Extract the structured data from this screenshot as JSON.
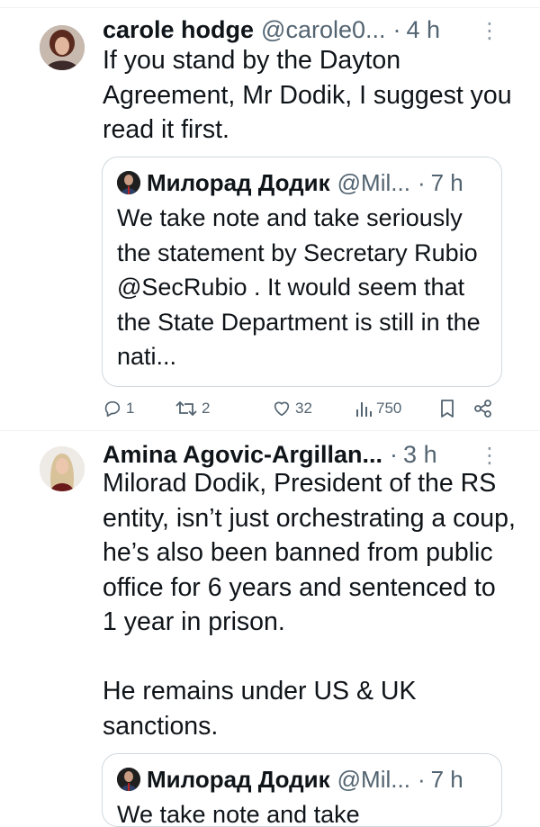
{
  "tweet1": {
    "name": "carole hodge",
    "handle": "@carole0...",
    "time": "4 h",
    "text": "If you stand by the Dayton Agreement, Mr Dodik, I suggest you read it first.",
    "quote": {
      "name": "Милорад Додик",
      "handle": "@Mil...",
      "time": "7 h",
      "text": "We take note and take seriously the statement by Secretary Rubio @SecRubio . It would seem that the State Department is still in the nati..."
    },
    "actions": {
      "replies": "1",
      "reposts": "2",
      "likes": "32",
      "views": "750"
    }
  },
  "tweet2": {
    "name": "Amina Agovic-Argillan...",
    "time": "3 h",
    "text_p1": "Milorad Dodik, President of the RS entity, isn’t just orchestrating a coup, he’s also been banned from public office for 6 years and sentenced to 1 year in prison.",
    "text_p2": "He remains under US & UK sanctions.",
    "quote": {
      "name": "Милорад Додик",
      "handle": "@Mil...",
      "time": "7 h",
      "text": "We take note and take"
    }
  },
  "separator_dot": "·",
  "more_glyph": "⋮"
}
